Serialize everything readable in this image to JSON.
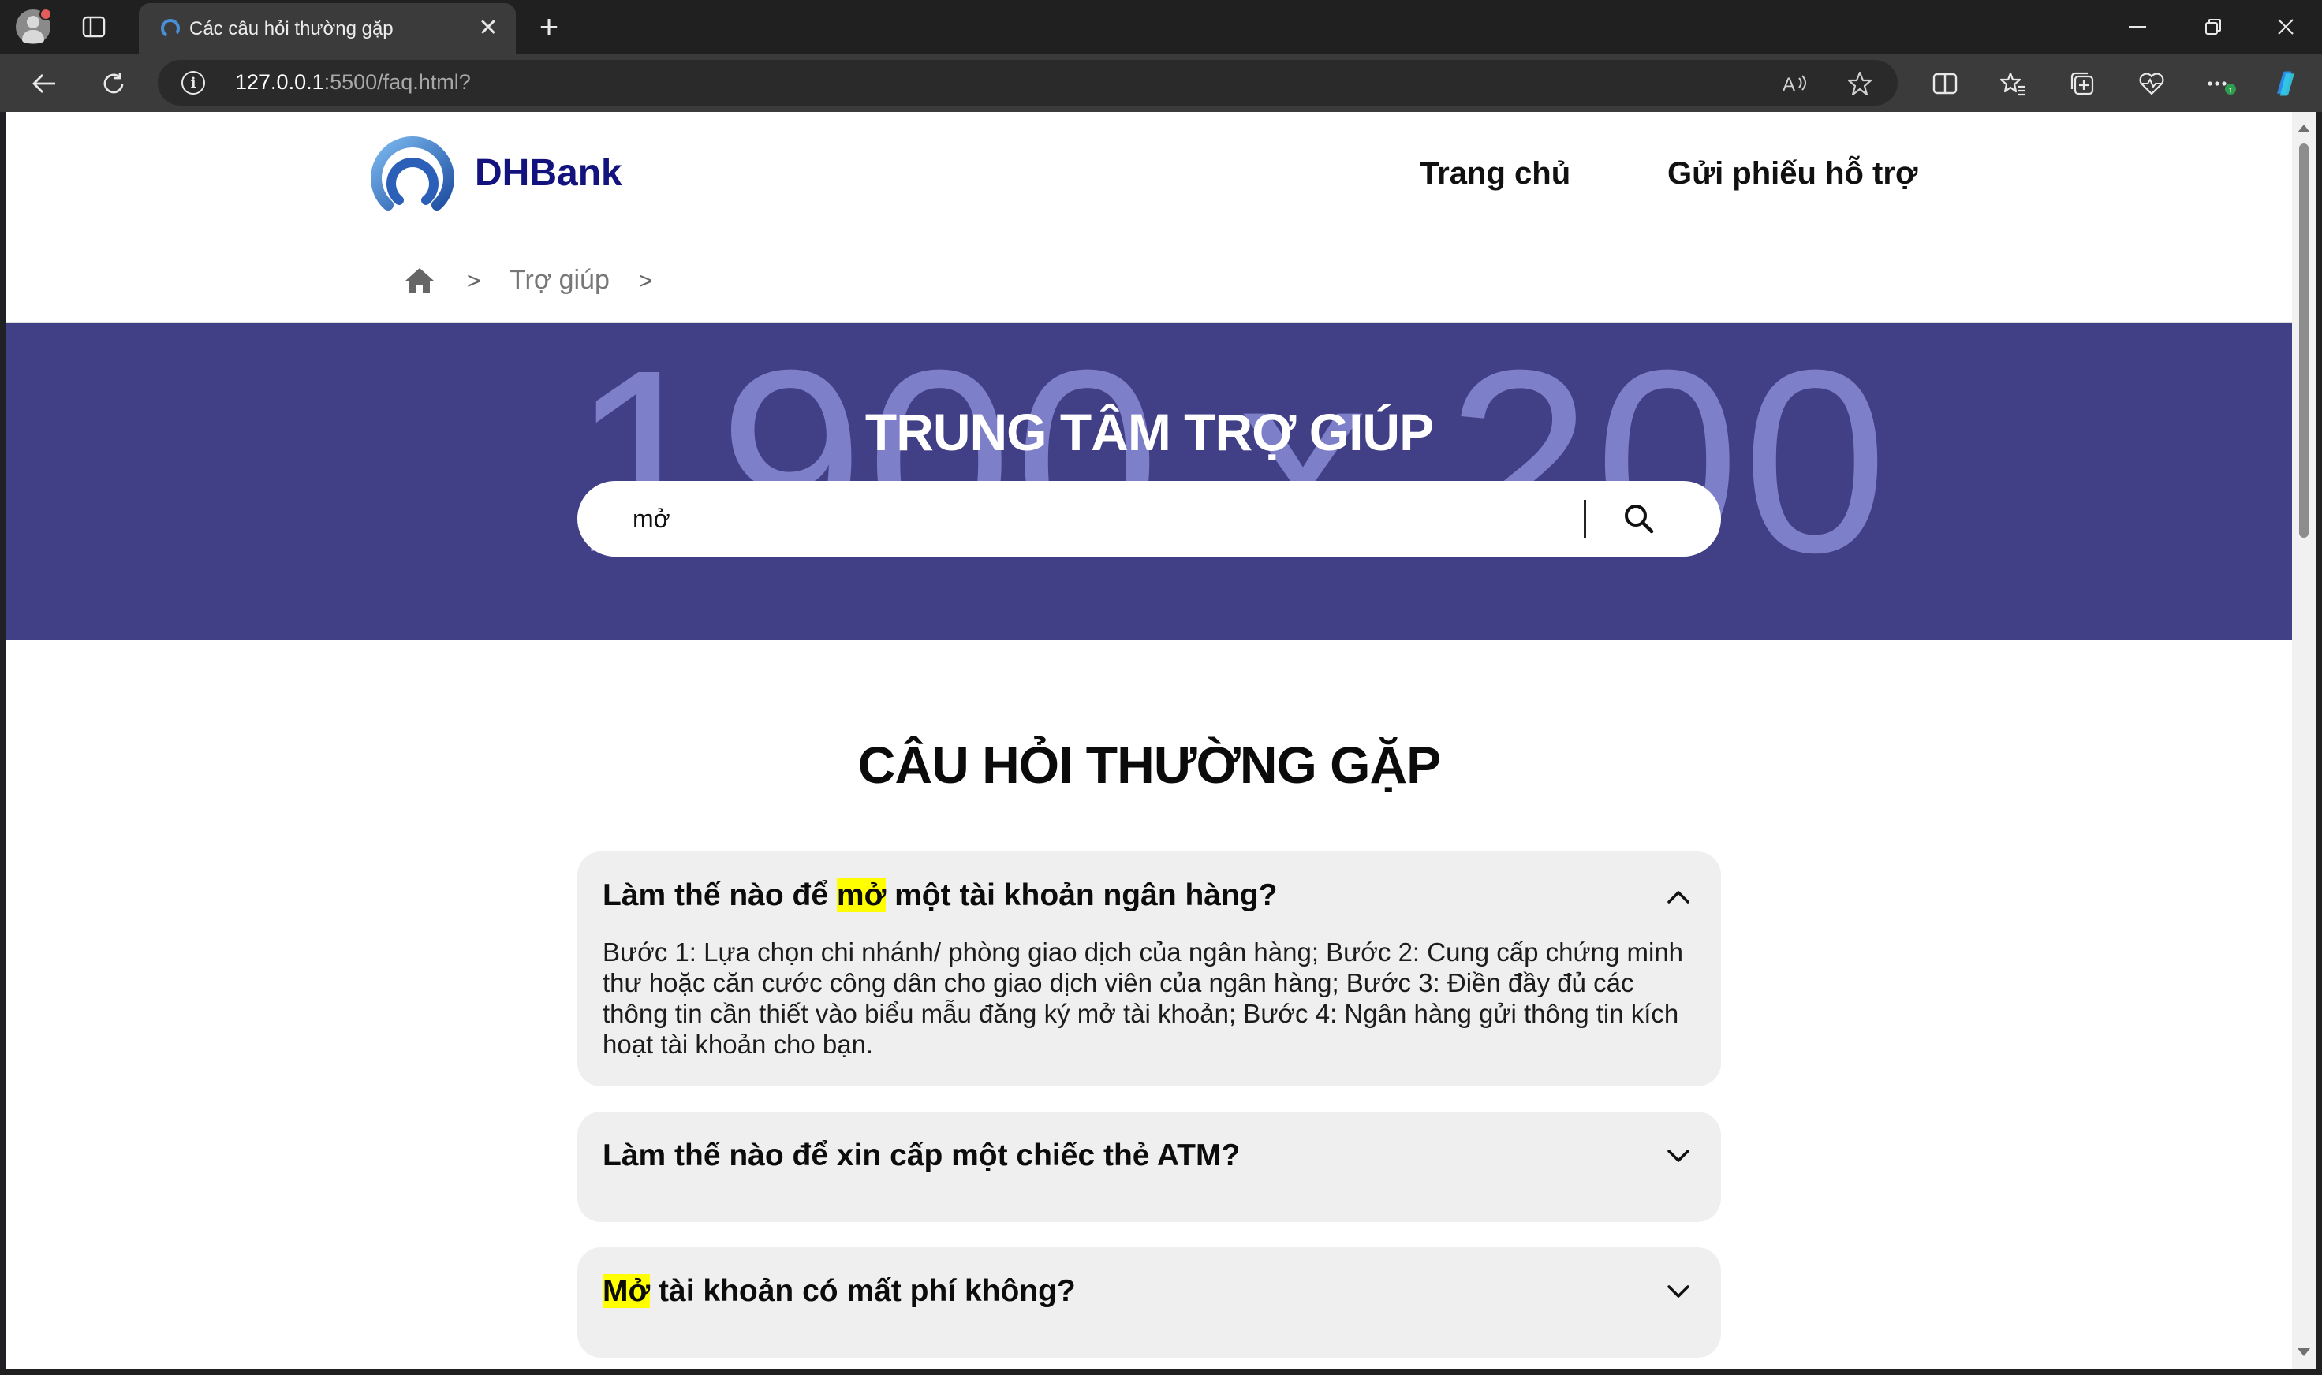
{
  "browser": {
    "tab_title": "Các câu hỏi thường gặp",
    "url_host": "127.0.0.1",
    "url_rest": ":5500/faq.html?"
  },
  "header": {
    "logo_text": "DHBank",
    "nav": [
      "Trang chủ",
      "Gửi phiếu hỗ trợ"
    ]
  },
  "breadcrumb": {
    "sep1": ">",
    "link": "Trợ giúp",
    "sep2": ">"
  },
  "hero": {
    "background_text": "1900 x 200",
    "title": "TRUNG TÂM TRỢ GIÚP",
    "search_value": "mở"
  },
  "faq": {
    "heading": "CÂU HỎI THƯỜNG GẶP",
    "items": [
      {
        "q_before": "Làm thế nào để ",
        "q_mark": "mở",
        "q_after": " một tài khoản ngân hàng?",
        "expanded": true,
        "answer": "Bước 1: Lựa chọn chi nhánh/ phòng giao dịch của ngân hàng; Bước 2: Cung cấp chứng minh thư hoặc căn cước công dân cho giao dịch viên của ngân hàng; Bước 3: Điền đầy đủ các thông tin cần thiết vào biểu mẫu đăng ký mở tài khoản; Bước 4: Ngân hàng gửi thông tin kích hoạt tài khoản cho bạn."
      },
      {
        "q_before": "Làm thế nào để xin cấp một chiếc thẻ ATM?",
        "expanded": false
      },
      {
        "q_mark": "Mở",
        "q_after": " tài khoản có mất phí không?",
        "expanded": false
      }
    ]
  },
  "colors": {
    "hero_bg": "#413f86",
    "hero_number": "#7e7fc9",
    "brand_text": "#13137e",
    "highlight": "#ffff00",
    "faq_card": "#efefef"
  }
}
